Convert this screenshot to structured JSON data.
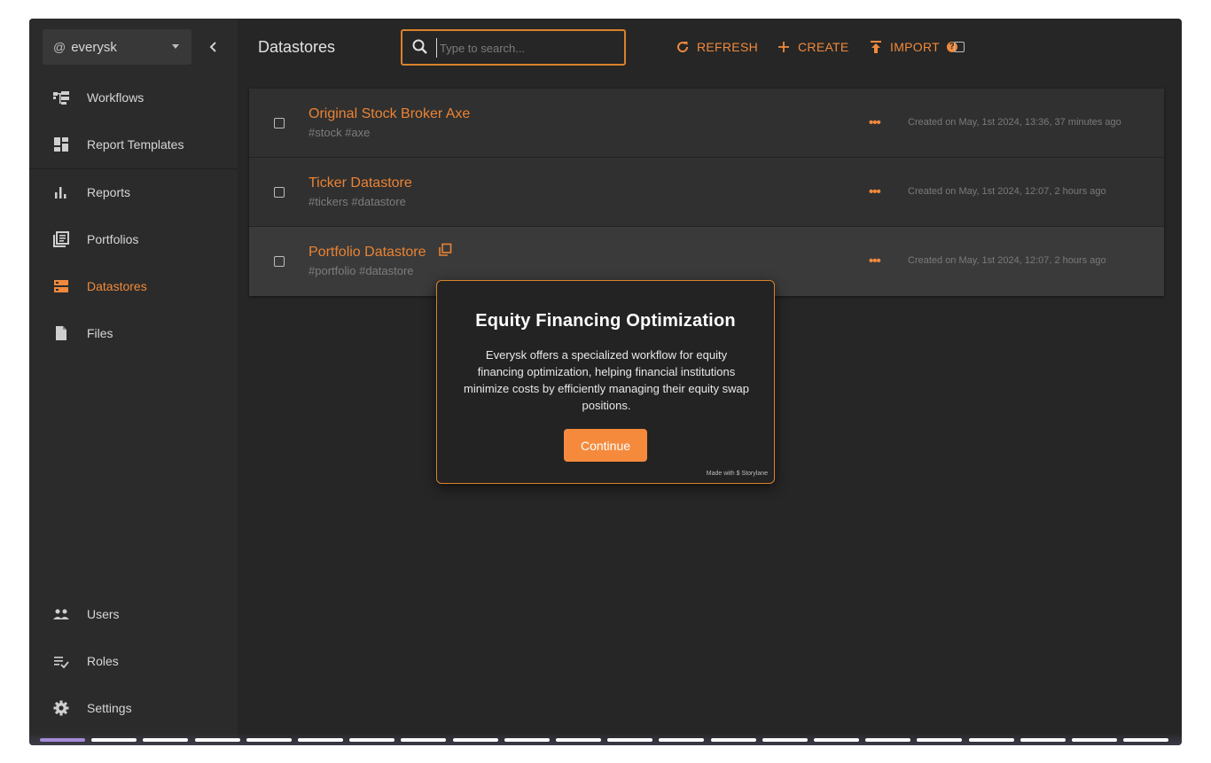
{
  "sidebar": {
    "org_at": "@",
    "org_name": "everysk",
    "items": [
      {
        "label": "Workflows",
        "icon": "workflow-icon"
      },
      {
        "label": "Report Templates",
        "icon": "dashboard-icon"
      },
      {
        "label": "Reports",
        "icon": "bar-chart-icon"
      },
      {
        "label": "Portfolios",
        "icon": "library-icon"
      },
      {
        "label": "Datastores",
        "icon": "storage-icon",
        "active": true
      },
      {
        "label": "Files",
        "icon": "file-icon"
      }
    ],
    "bottom_items": [
      {
        "label": "Users",
        "icon": "users-icon"
      },
      {
        "label": "Roles",
        "icon": "checklist-icon"
      },
      {
        "label": "Settings",
        "icon": "gear-icon"
      }
    ]
  },
  "header": {
    "title": "Datastores",
    "search_placeholder": "Type to search...",
    "refresh_label": "REFRESH",
    "create_label": "CREATE",
    "import_label": "IMPORT",
    "import_help": "?"
  },
  "datastores": [
    {
      "title": "Original Stock Broker Axe",
      "tags": "#stock #axe",
      "more": "•••",
      "created": "Created on May, 1st 2024, 13:36, 37 minutes ago"
    },
    {
      "title": "Ticker Datastore",
      "tags": "#tickers #datastore",
      "more": "•••",
      "created": "Created on May, 1st 2024, 12:07, 2 hours ago"
    },
    {
      "title": "Portfolio Datastore",
      "tags": "#portfolio #datastore",
      "more": "•••",
      "created": "Created on May, 1st 2024, 12:07, 2 hours ago"
    }
  ],
  "modal": {
    "title": "Equity Financing Optimization",
    "body": "Everysk offers a specialized workflow for equity financing optimization, helping financial institutions minimize costs by efficiently managing their equity swap positions.",
    "button": "Continue",
    "footer": "Made with $ Storylane"
  },
  "colors": {
    "accent": "#f08a3c",
    "background": "#262626",
    "sidebar": "#2b2b2b",
    "progress_done": "#a38bd8"
  },
  "progress": {
    "total_steps": 22,
    "completed_steps": 1
  }
}
